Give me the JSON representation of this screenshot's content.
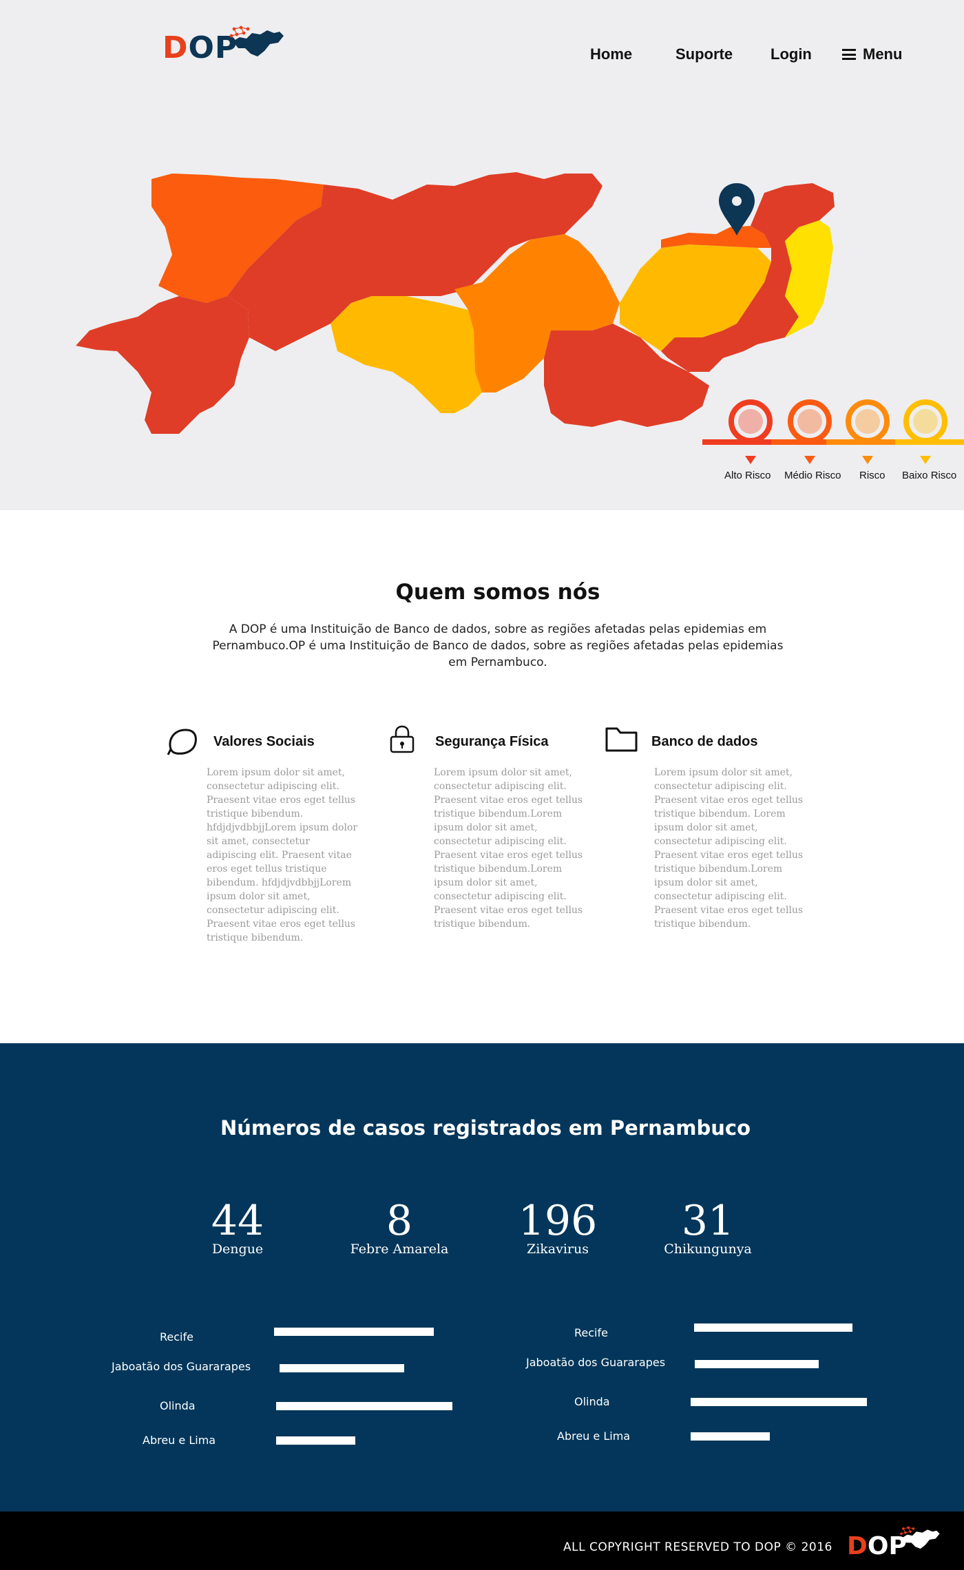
{
  "brand": {
    "logo_part1": "D",
    "logo_part2": "OP"
  },
  "nav": {
    "home": "Home",
    "suporte": "Suporte",
    "login": "Login",
    "menu": "Menu"
  },
  "map": {
    "region_colors": [
      "#df3d27",
      "#fb5c0d",
      "#ff8300",
      "#ffba00",
      "#ffe000"
    ],
    "pin_color": "#0d3554"
  },
  "legend": [
    {
      "label": "Alto Risco",
      "color": "#f03c20"
    },
    {
      "label": "Médio Risco",
      "color": "#fb5a12"
    },
    {
      "label": "Risco",
      "color": "#ff8b0c"
    },
    {
      "label": "Baixo Risco",
      "color": "#ffbe00"
    }
  ],
  "about": {
    "title": "Quem somos nós",
    "text": "A DOP é uma Instituição de Banco de dados, sobre as regiões afetadas pelas epidemias em Pernambuco.OP é uma Instituição de Banco de dados, sobre as regiões afetadas pelas epidemias em Pernambuco."
  },
  "features": [
    {
      "icon": "leaf-icon",
      "title": "Valores Sociais",
      "body": "Lorem ipsum dolor sit amet, consectetur adipiscing elit. Praesent vitae eros eget tellus tristique bibendum. hfdjdjvdbbjjLorem ipsum dolor sit amet, consectetur adipiscing elit. Praesent vitae eros eget tellus tristique bibendum. hfdjdjvdbbjjLorem ipsum dolor sit amet, consectetur adipiscing elit. Praesent vitae eros eget tellus tristique bibendum."
    },
    {
      "icon": "lock-icon",
      "title": "Segurança Física",
      "body": "Lorem ipsum dolor sit amet, consectetur adipiscing elit. Praesent vitae eros eget tellus tristique bibendum.Lorem ipsum dolor sit amet, consectetur adipiscing elit. Praesent vitae eros eget tellus tristique bibendum.Lorem ipsum dolor sit amet, consectetur adipiscing elit. Praesent vitae eros eget tellus tristique bibendum."
    },
    {
      "icon": "folder-icon",
      "title": "Banco de dados",
      "body": "Lorem ipsum dolor sit amet, consectetur adipiscing elit. Praesent vitae eros eget tellus tristique bibendum. Lorem ipsum dolor sit amet, consectetur adipiscing elit. Praesent vitae eros eget tellus tristique bibendum.Lorem ipsum dolor sit amet, consectetur adipiscing elit. Praesent vitae eros eget tellus tristique bibendum."
    }
  ],
  "stats": {
    "title": "Números de casos registrados em Pernambuco",
    "counters": [
      {
        "value": "44",
        "label": "Dengue"
      },
      {
        "value": "8",
        "label": "Febre Amarela"
      },
      {
        "value": "196",
        "label": "Zikavirus"
      },
      {
        "value": "31",
        "label": "Chikungunya"
      }
    ],
    "bars_left": [
      {
        "label": "Recife",
        "fraction": 0.9
      },
      {
        "label": "Jaboatão dos Guararapes",
        "fraction": 0.7
      },
      {
        "label": "Olinda",
        "fraction": 1.0
      },
      {
        "label": "Abreu e Lima",
        "fraction": 0.45
      }
    ],
    "bars_right": [
      {
        "label": "Recife",
        "fraction": 0.9
      },
      {
        "label": "Jaboatão dos Guararapes",
        "fraction": 0.7
      },
      {
        "label": "Olinda",
        "fraction": 1.0
      },
      {
        "label": "Abreu e Lima",
        "fraction": 0.45
      }
    ]
  },
  "footer": {
    "copyright": "ALL COPYRIGHT RESERVED TO DOP © 2016",
    "logo_part1": "D",
    "logo_part2": "OP"
  }
}
